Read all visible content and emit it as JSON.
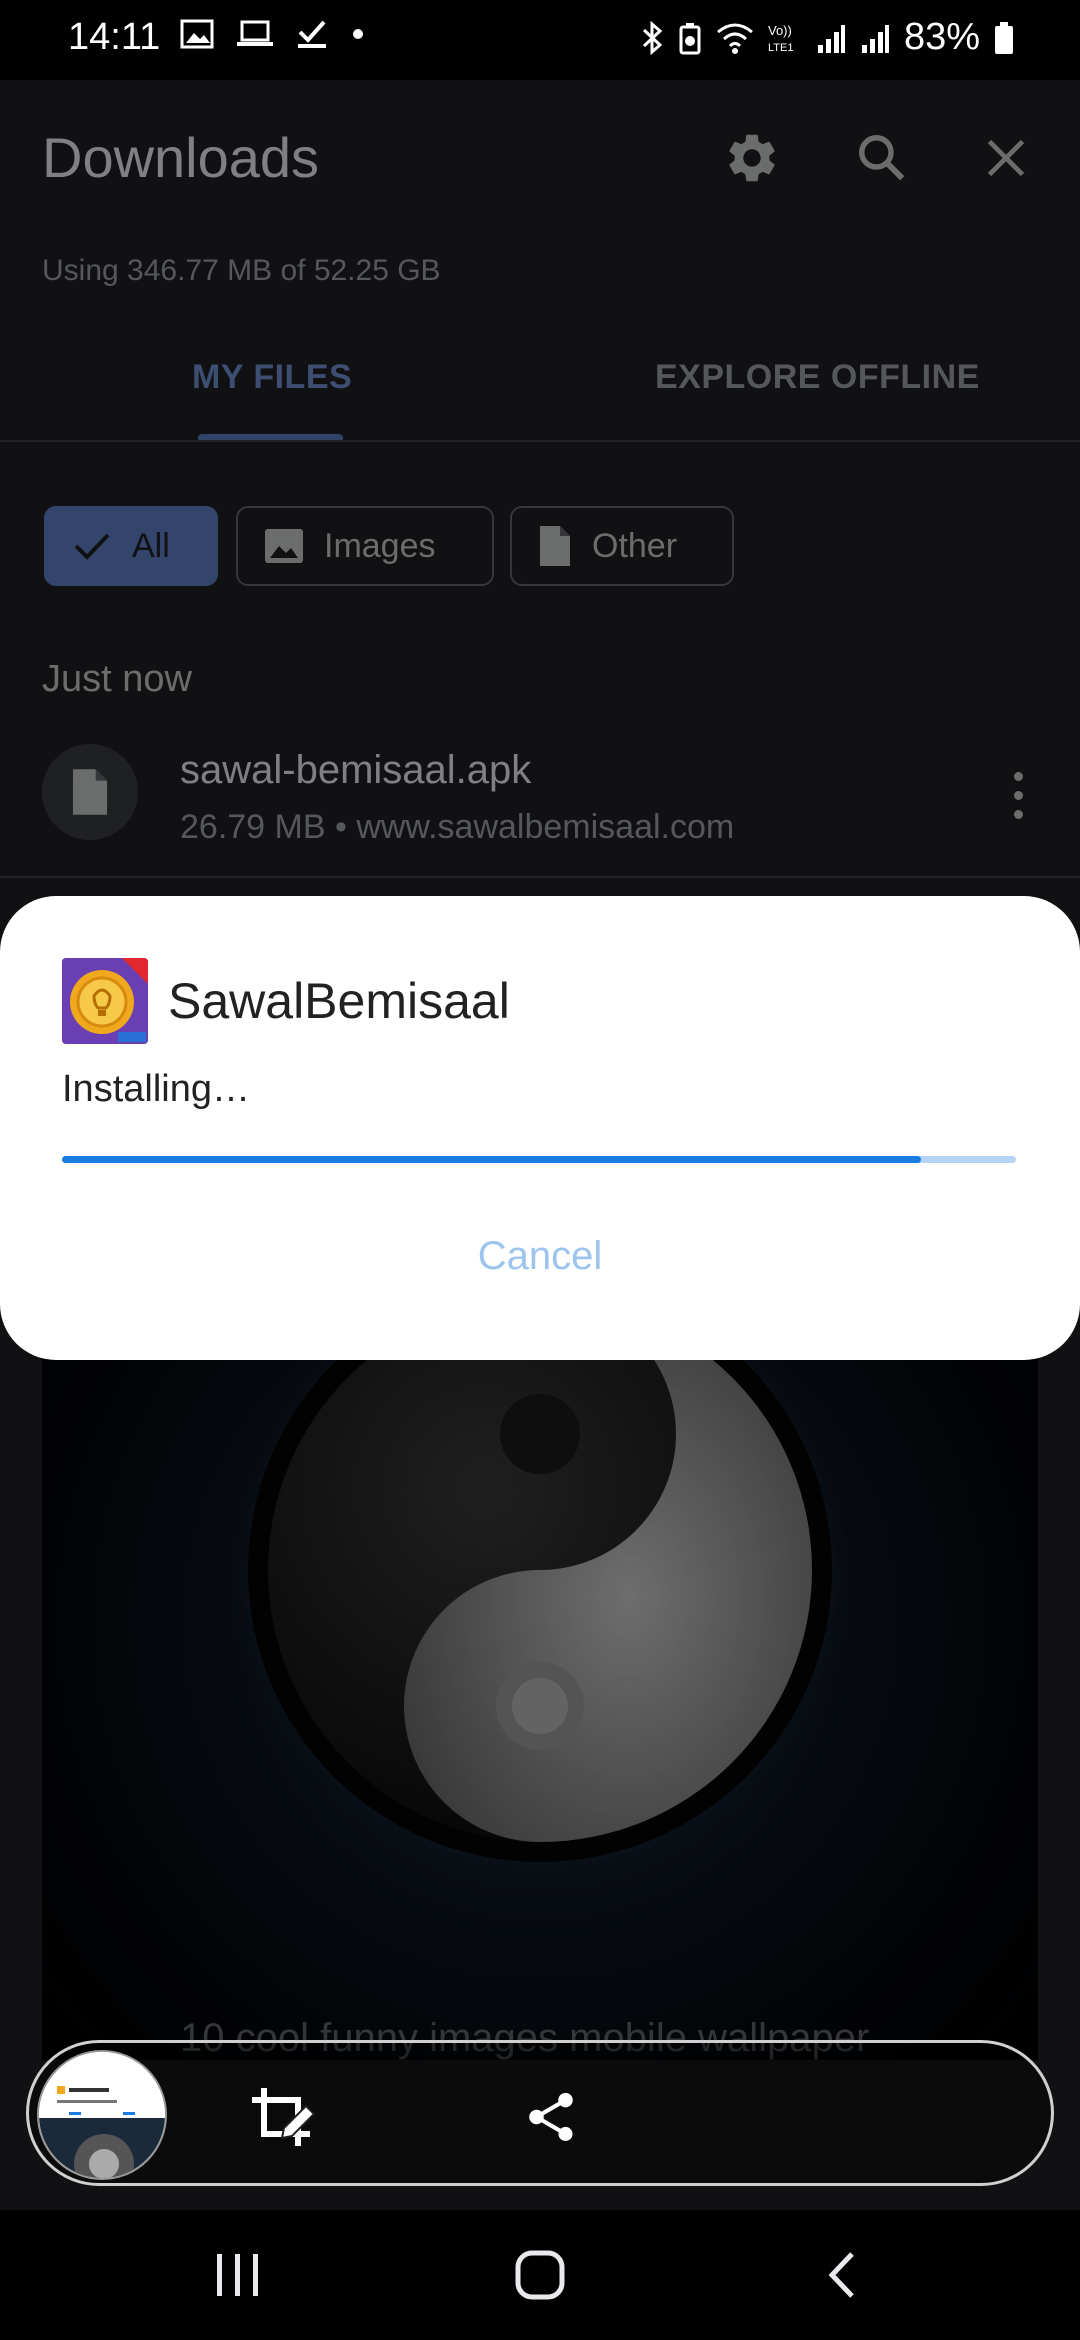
{
  "status_bar": {
    "time": "14:11",
    "battery": "83%",
    "left_icons": [
      "image-icon",
      "laptop-icon",
      "checkbox-icon",
      "dot-icon"
    ],
    "right_icons": [
      "bluetooth-icon",
      "battery-saver-icon",
      "wifi-icon",
      "volte-icon",
      "signal-icon",
      "signal-icon",
      "battery-icon"
    ]
  },
  "header": {
    "title": "Downloads",
    "storage_info": "Using 346.77 MB of 52.25 GB",
    "icons": [
      "settings-icon",
      "search-icon",
      "close-icon"
    ]
  },
  "tabs": [
    {
      "label": "MY FILES",
      "active": true
    },
    {
      "label": "EXPLORE OFFLINE",
      "active": false
    }
  ],
  "filters": [
    {
      "label": "All",
      "icon": "check-icon",
      "selected": true
    },
    {
      "label": "Images",
      "icon": "image-icon",
      "selected": false
    },
    {
      "label": "Other",
      "icon": "file-icon",
      "selected": false
    }
  ],
  "section_label": "Just now",
  "file": {
    "name": "sawal-bemisaal.apk",
    "meta": "26.79 MB • www.sawalbemisaal.com"
  },
  "next_file_title": "10 cool funny images mobile wallpaper",
  "dialog": {
    "app_name": "SawalBemisaal",
    "status": "Installing…",
    "progress_fraction": 0.9,
    "cancel_label": "Cancel"
  },
  "bottom_toolbar": {
    "icons": [
      "screenshot-thumbnail",
      "crop-edit-icon",
      "share-icon"
    ]
  },
  "nav_bar": {
    "icons": [
      "recents-icon",
      "home-icon",
      "back-icon"
    ]
  },
  "colors": {
    "accent": "#6f8fcf",
    "chip_selected": "#5d7fc4",
    "progress": "#1a7be0",
    "cancel": "#9dc4ec"
  }
}
